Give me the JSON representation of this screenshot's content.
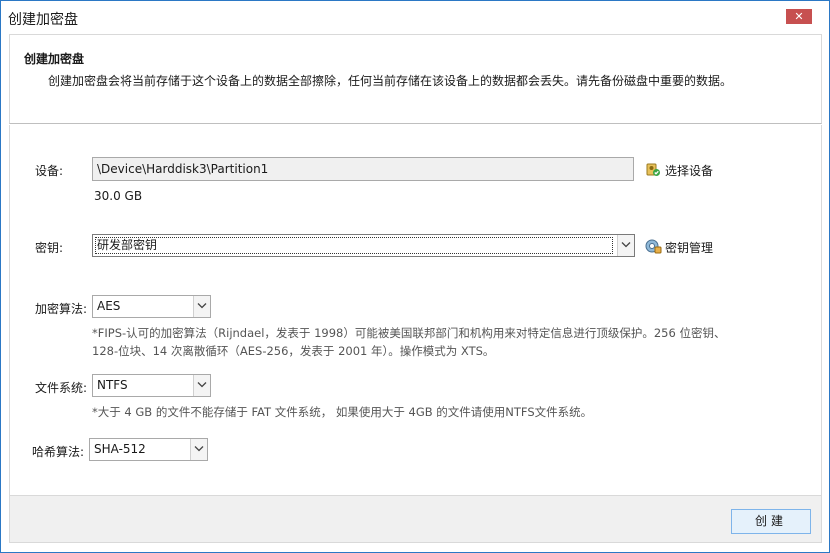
{
  "window": {
    "title": "创建加密盘",
    "close_symbol": "✕"
  },
  "header": {
    "title": "创建加密盘",
    "description": "创建加密盘会将当前存储于这个设备上的数据全部擦除，任何当前存储在该设备上的数据都会丢失。请先备份磁盘中重要的数据。"
  },
  "device": {
    "label": "设备:",
    "value": "\\Device\\Harddisk3\\Partition1",
    "size": "30.0 GB",
    "select_button": "选择设备"
  },
  "key": {
    "label": "密钥:",
    "selected": "研发部密钥",
    "manage_button": "密钥管理"
  },
  "algorithm": {
    "label": "加密算法:",
    "selected": "AES",
    "note_line1": "*FIPS-认可的加密算法（Rijndael，发表于 1998）可能被美国联邦部门和机构用来对特定信息进行顶级保护。256 位密钥、",
    "note_line2": "128-位块、14 次离散循环（AES-256，发表于 2001 年）。操作模式为 XTS。"
  },
  "filesystem": {
    "label": "文件系统:",
    "selected": "NTFS",
    "note": "*大于 4 GB 的文件不能存储于 FAT 文件系统， 如果使用大于 4GB 的文件请使用NTFS文件系统。"
  },
  "hash": {
    "label": "哈希算法:",
    "selected": "SHA-512"
  },
  "footer": {
    "create_button": "创建"
  },
  "colors": {
    "accent": "#2b78c5",
    "close": "#c75050",
    "button_bg": "#e5f1fb"
  },
  "icons": [
    "close-icon",
    "select-device-icon",
    "key-manage-icon",
    "dropdown-arrow-icon"
  ]
}
